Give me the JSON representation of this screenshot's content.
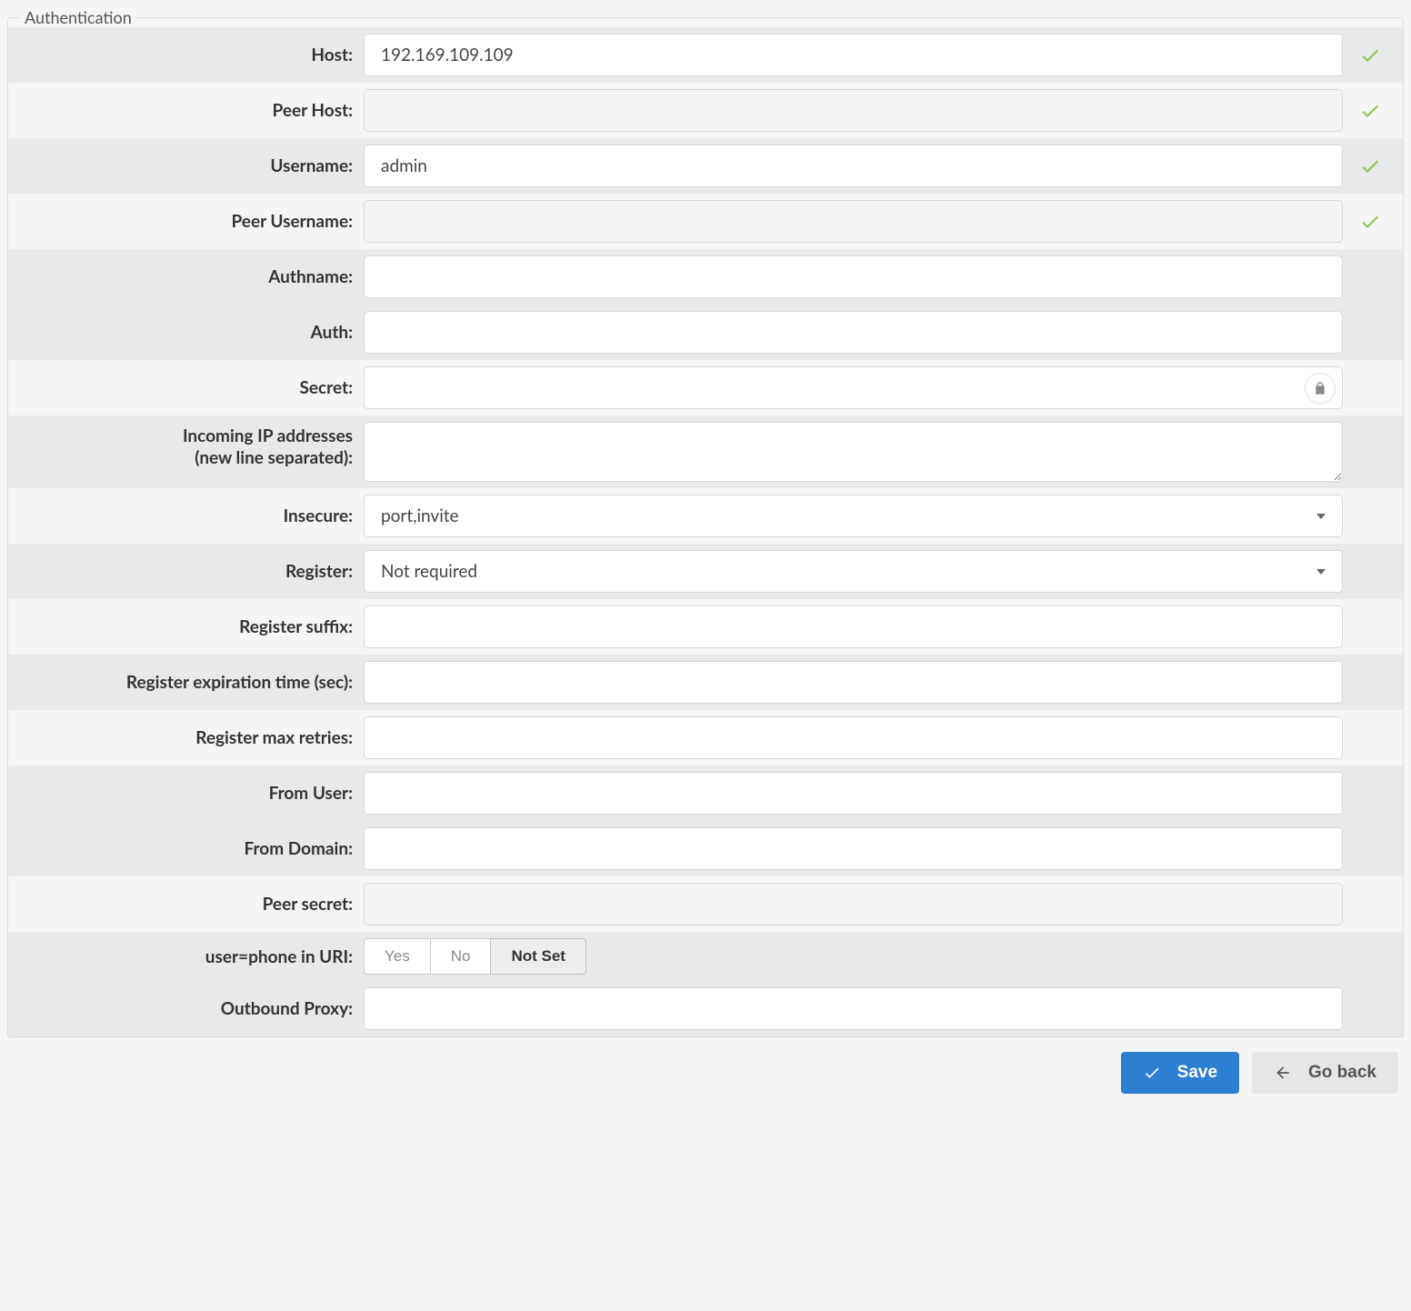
{
  "legend": "Authentication",
  "fields": {
    "host": {
      "label": "Host:",
      "value": "192.169.109.109"
    },
    "peer_host": {
      "label": "Peer Host:",
      "value": ""
    },
    "username": {
      "label": "Username:",
      "value": "admin"
    },
    "peer_username": {
      "label": "Peer Username:",
      "value": ""
    },
    "authname": {
      "label": "Authname:",
      "value": ""
    },
    "auth": {
      "label": "Auth:",
      "value": ""
    },
    "secret": {
      "label": "Secret:",
      "value": ""
    },
    "incoming_ip_l1": "Incoming IP addresses",
    "incoming_ip_l2": "(new line separated):",
    "incoming_ip": {
      "value": ""
    },
    "insecure": {
      "label": "Insecure:",
      "value": "port,invite"
    },
    "register": {
      "label": "Register:",
      "value": "Not required"
    },
    "register_suffix": {
      "label": "Register suffix:",
      "value": ""
    },
    "register_expire": {
      "label": "Register expiration time (sec):",
      "value": ""
    },
    "register_retries": {
      "label": "Register max retries:",
      "value": ""
    },
    "from_user": {
      "label": "From User:",
      "value": ""
    },
    "from_domain": {
      "label": "From Domain:",
      "value": ""
    },
    "peer_secret": {
      "label": "Peer secret:",
      "value": ""
    },
    "user_phone": {
      "label": "user=phone in URI:",
      "options": [
        "Yes",
        "No",
        "Not Set"
      ],
      "selected": "Not Set"
    },
    "outbound_proxy": {
      "label": "Outbound Proxy:",
      "value": ""
    }
  },
  "buttons": {
    "save": "Save",
    "goback": "Go back"
  }
}
